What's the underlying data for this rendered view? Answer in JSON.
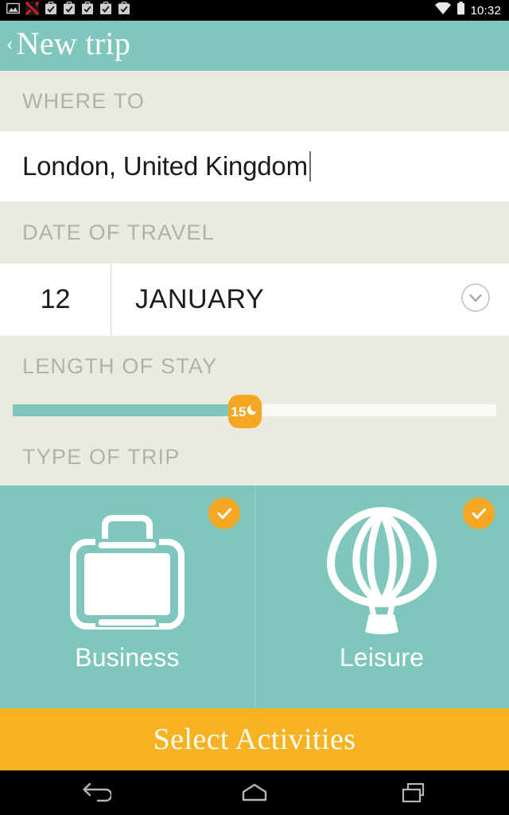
{
  "statusbar": {
    "time": "10:32",
    "left_icons": [
      "image-icon",
      "app-alert-icon",
      "clipboard-check-icon",
      "clipboard-check-icon",
      "clipboard-check-icon",
      "clipboard-check-icon",
      "clipboard-check-icon"
    ],
    "right_icons": [
      "wifi-icon",
      "battery-icon"
    ]
  },
  "header": {
    "back_label": "‹",
    "title": "New trip"
  },
  "where_to": {
    "label": "WHERE TO",
    "value": "London, United Kingdom",
    "placeholder": "Where to"
  },
  "date_of_travel": {
    "label": "DATE OF TRAVEL",
    "day": "12",
    "month": "JANUARY",
    "dropdown_icon": "chevron-down-icon"
  },
  "length_of_stay": {
    "label": "LENGTH OF STAY",
    "value": "15",
    "unit_icon": "moon-icon",
    "min": 0,
    "max": 32,
    "fill_percent": 45
  },
  "type_of_trip": {
    "label": "TYPE OF TRIP",
    "options": [
      {
        "label": "Business",
        "icon": "briefcase-icon",
        "selected": true,
        "badge_icon": "check-icon"
      },
      {
        "label": "Leisure",
        "icon": "hot-air-balloon-icon",
        "selected": true,
        "badge_icon": "check-icon"
      }
    ]
  },
  "cta": {
    "label": "Select Activities"
  },
  "navbar": {
    "back": "back-arrow-icon",
    "home": "home-icon",
    "recents": "recents-icon"
  },
  "colors": {
    "teal": "#7FC7BC",
    "beige": "#EBEAE0",
    "orange": "#F7B223",
    "badge_orange": "#F5A623",
    "white": "#FFFFFF",
    "label_gray": "#B2B1A7"
  }
}
